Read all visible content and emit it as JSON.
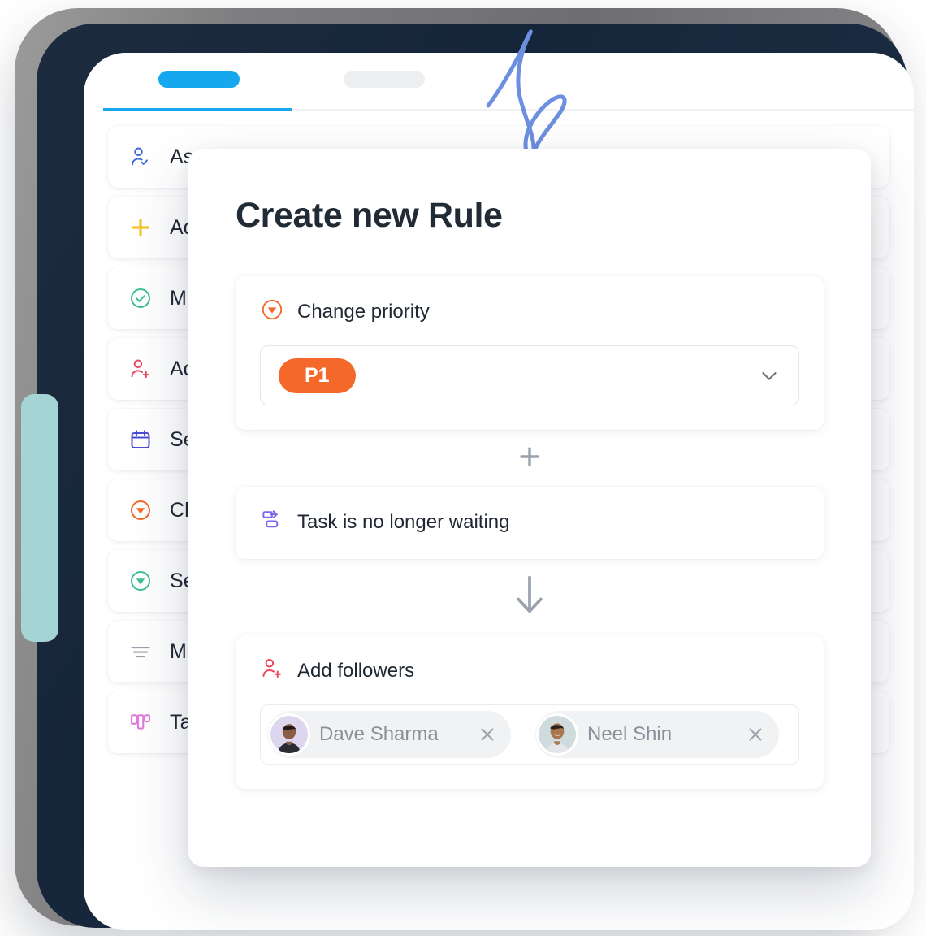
{
  "theme": {
    "accent_blue": "#17a7ee",
    "orange": "#f4682a",
    "teal": "#a5d4d4",
    "bezel": "#1d2b3f",
    "text": "#1f2733"
  },
  "phone_app": {
    "tabs": [
      {
        "name": "tab-one",
        "state": "active",
        "label": ""
      },
      {
        "name": "tab-two",
        "state": "idle",
        "label": ""
      }
    ],
    "action_list": [
      {
        "icon": "person-check-icon",
        "label": "Assign to",
        "color": "#3f6bd4"
      },
      {
        "icon": "plus-icon",
        "label": "Add to p",
        "color": "#f5c32c"
      },
      {
        "icon": "check-circle-icon",
        "label": "Mark tas",
        "color": "#3bbf96"
      },
      {
        "icon": "person-plus-icon",
        "label": "Add follo",
        "color": "#e8485f"
      },
      {
        "icon": "calendar-icon",
        "label": "Set due ",
        "color": "#4c4ad8"
      },
      {
        "icon": "priority-down-icon",
        "label": "Change p",
        "color": "#f4682a"
      },
      {
        "icon": "status-down-icon",
        "label": "Set to",
        "color": "#3bbf96"
      },
      {
        "icon": "move-lines-icon",
        "label": "Move to",
        "color": "#9aa2ad"
      },
      {
        "icon": "board-icon",
        "label": "Task mov",
        "color": "#e07ddb"
      }
    ]
  },
  "dialog": {
    "title": "Create new Rule",
    "action_block": {
      "icon": "priority-down-icon",
      "label": "Change priority",
      "field": {
        "selected_value": "P1",
        "chevron_icon": "chevron-down-icon"
      }
    },
    "add_connector_icon": "plus-icon",
    "trigger_block": {
      "icon": "task-waiting-icon",
      "label": "Task is no longer waiting"
    },
    "flow_connector_icon": "arrow-down-icon",
    "followers_block": {
      "icon": "person-plus-icon",
      "label": "Add followers",
      "chips": [
        {
          "name": "Dave Sharma",
          "avatar": "avatar-dave",
          "close_icon": "close-icon"
        },
        {
          "name": "Neel Shin",
          "avatar": "avatar-neel",
          "close_icon": "close-icon"
        }
      ]
    }
  },
  "decorations": {
    "squiggle": "squiggle-doodle",
    "teal_right": "teal-square-shape",
    "teal_left": "teal-tab-shape"
  }
}
